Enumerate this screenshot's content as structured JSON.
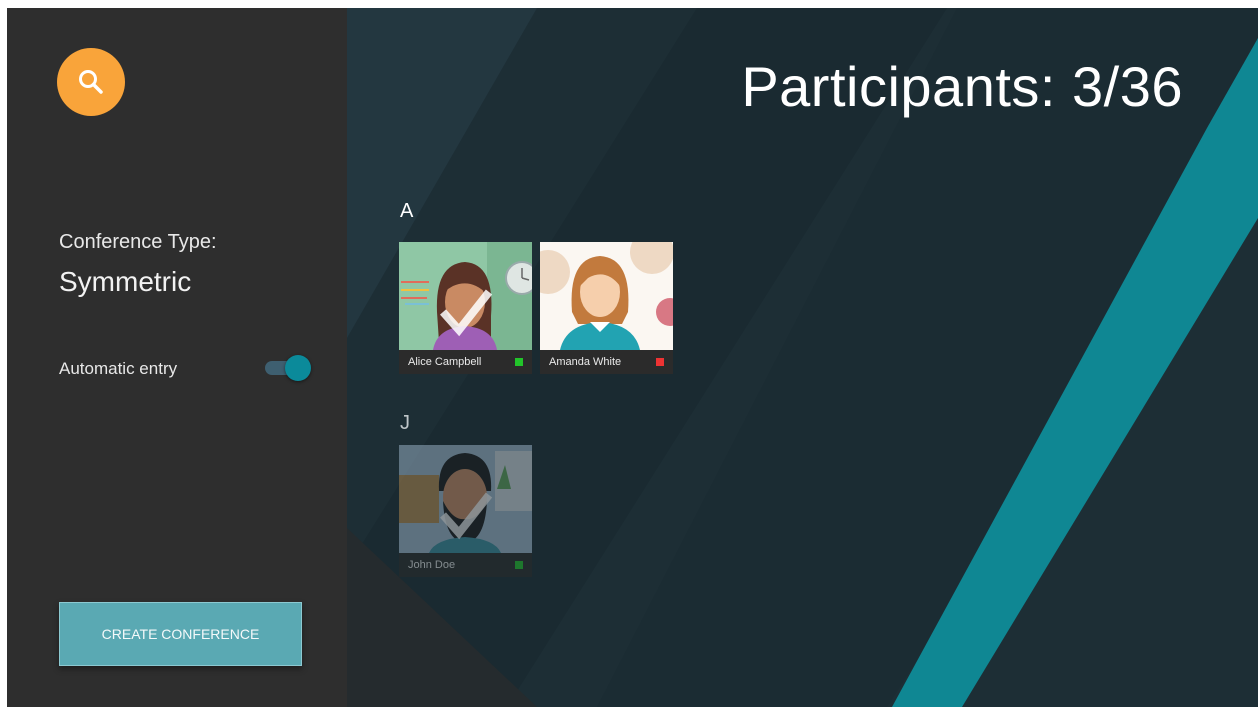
{
  "sidebar": {
    "conference_type_label": "Conference Type:",
    "conference_type_value": "Symmetric",
    "automatic_entry_label": "Automatic entry",
    "automatic_entry_on": true,
    "create_button_label": "CREATE CONFERENCE",
    "search_icon": "search-icon"
  },
  "main": {
    "title": "Participants: 3/36",
    "groups": [
      {
        "letter": "A",
        "participants": [
          {
            "name": "Alice Campbell",
            "status": "green",
            "selected": true
          },
          {
            "name": "Amanda White",
            "status": "red",
            "selected": false
          }
        ]
      },
      {
        "letter": "J",
        "participants": [
          {
            "name": "John Doe",
            "status": "green",
            "selected": true,
            "dimmed": true
          }
        ]
      }
    ]
  },
  "colors": {
    "accent_orange": "#f9a43a",
    "accent_teal": "#0b8a9a",
    "sidebar_bg": "#2e2e2e",
    "main_bg": "#1d2e35",
    "status_green": "#22c42a",
    "status_red": "#ee3333"
  }
}
